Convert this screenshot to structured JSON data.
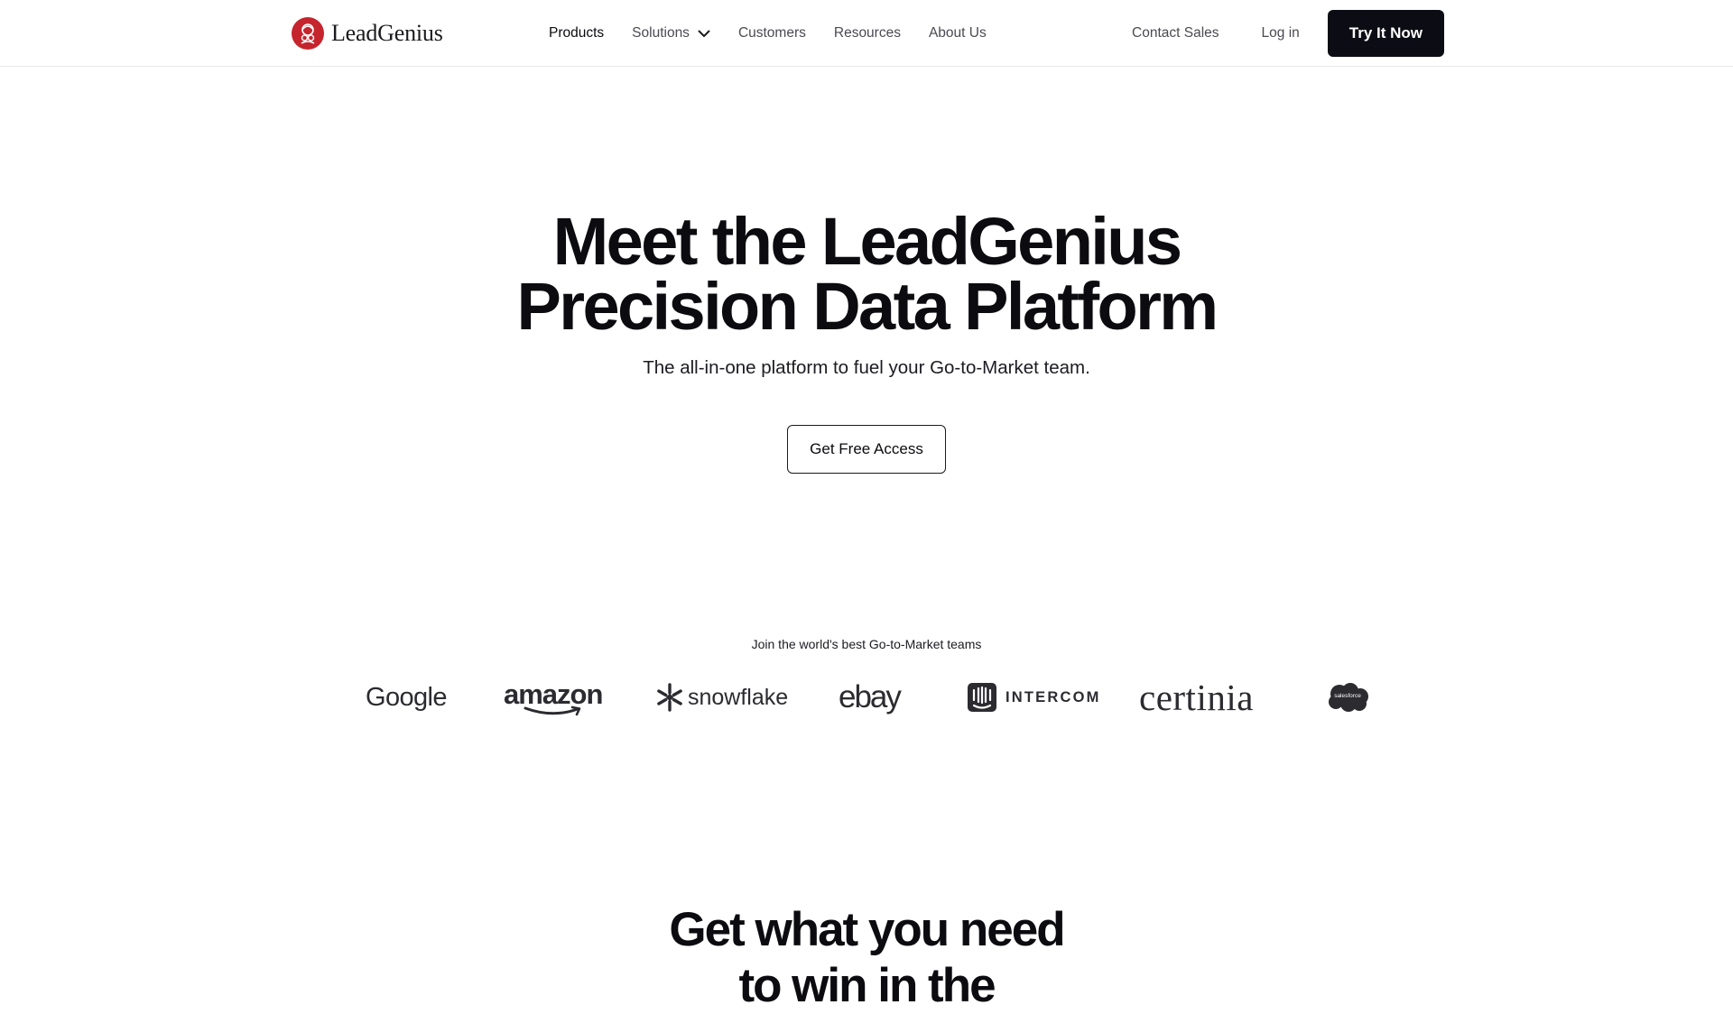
{
  "nav": {
    "brand": "LeadGenius",
    "links": [
      {
        "label": "Products"
      },
      {
        "label": "Solutions"
      },
      {
        "label": "Customers"
      },
      {
        "label": "Resources"
      },
      {
        "label": "About Us"
      }
    ],
    "contact_sales": "Contact Sales",
    "login": "Log in",
    "try_now": "Try It Now"
  },
  "hero": {
    "title_line1": "Meet the LeadGenius",
    "title_line2": "Precision Data Platform",
    "subtitle": "The all-in-one platform to fuel your Go-to-Market team.",
    "cta": "Get Free Access"
  },
  "logos": {
    "caption": "Join the world's best Go-to-Market teams",
    "items": [
      {
        "name": "Google"
      },
      {
        "name": "amazon"
      },
      {
        "name": "snowflake"
      },
      {
        "name": "ebay"
      },
      {
        "name": "INTERCOM"
      },
      {
        "name": "certinia"
      },
      {
        "name": "salesforce"
      }
    ]
  },
  "section": {
    "title_line1": "Get what you need",
    "title_line2": "to win in the"
  },
  "colors": {
    "brand_red": "#c5252d",
    "dark_button": "#0c0d14",
    "logo_gray": "#2b2b30"
  },
  "icons": {
    "solutions_dropdown": "chevron-down-icon",
    "brand": "leadgenius-logo-icon"
  }
}
